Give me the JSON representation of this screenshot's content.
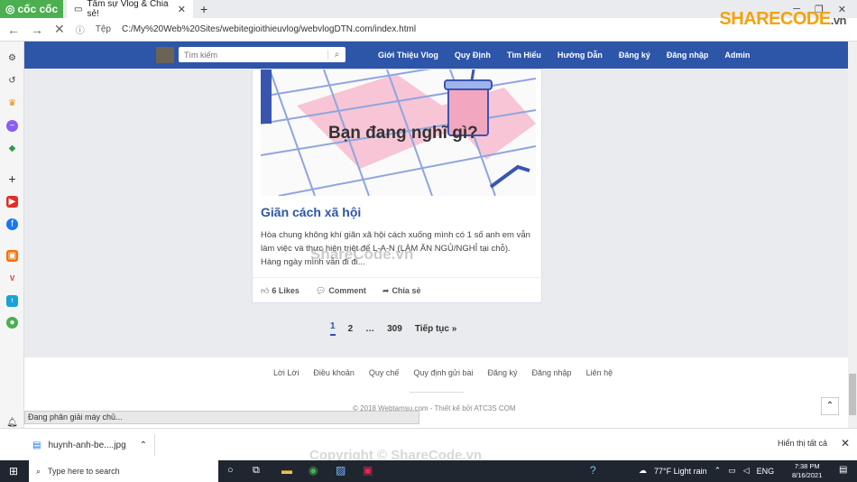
{
  "browser": {
    "brand": "cốc cốc",
    "tab_title": "Tâm sự Vlog & Chia sẻ!",
    "new_tab": "+",
    "protocol": "Tệp",
    "url": "C:/My%20Web%20Sites/webitegioithieuvlog/webvlogDTN.com/index.html"
  },
  "watermark": {
    "logo": "SHARECODE",
    "logo_suffix": ".vn",
    "center": "ShareCode.vn",
    "bottom": "Copyright © ShareCode.vn"
  },
  "site": {
    "search_placeholder": "Tìm kiếm",
    "menu": [
      "Giới Thiệu Vlog",
      "Quy Định",
      "Tìm Hiểu",
      "Hướng Dẫn",
      "Đăng ký",
      "Đăng nhập",
      "Admin"
    ]
  },
  "post": {
    "image_caption": "Bạn đang nghĩ gì?",
    "title": "Giãn cách xã hội",
    "excerpt": "Hòa chung không khí giãn xã hội cách xuống mình có 1 số anh em vẫn làm việc và thực hiện triệt để L-A-N (LÀM ĂN NGỦ/NGHỈ tại chỗ). Hàng ngày mình vẫn đi đi...",
    "likes": "6 Likes",
    "comment": "Comment",
    "share": "Chia sẻ"
  },
  "pagination": {
    "pages": [
      "1",
      "2",
      "…",
      "309"
    ],
    "next": "Tiếp tục »",
    "active": "1"
  },
  "footer": {
    "links": [
      "Lời Lời",
      "Điều khoản",
      "Quy chế",
      "Quy định gửi bài",
      "Đăng ký",
      "Đăng nhập",
      "Liên hệ"
    ],
    "copyright": "© 2018 Webtamsu.com - Thiết kế bởi ATC3S COM"
  },
  "status_text": "Đang phân giải máy chủ...",
  "download": {
    "file": "huynh-anh-be....jpg",
    "show_all": "Hiển thị tất cả"
  },
  "taskbar": {
    "search_placeholder": "Type here to search",
    "weather": "77°F Light rain",
    "lang": "ENG",
    "time": "7:38 PM",
    "date": "8/16/2021"
  },
  "colors": {
    "nav": "#2d55a8",
    "title": "#2d55a8",
    "brand": "#4caf50"
  }
}
